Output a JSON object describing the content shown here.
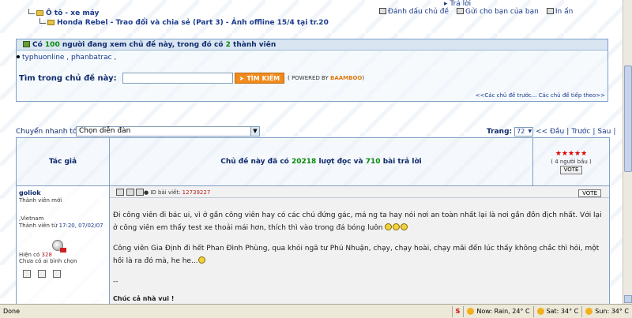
{
  "breadcrumb": {
    "level1": "Ô tô - xe máy",
    "level2": "Honda Rebel - Trao đổi và chia sẻ (Part 3) - Ảnh offline 15/4 tại tr.20"
  },
  "top_links": {
    "reply": "Trả lời",
    "bookmark": "Đánh dấu chủ đề",
    "send_friend": "Gửi cho bạn của bạn",
    "print": "In ấn"
  },
  "viewers": {
    "prefix": "Có ",
    "count": "100",
    "middle": " người đang xem chủ đề này, trong đó có ",
    "members_count": "2",
    "suffix": " thành viên",
    "members_list": "typhuonline , phanbatrac ,"
  },
  "search": {
    "label": "Tìm trong chủ đề này:",
    "value": "",
    "button": "TÌM KIẾM",
    "powered_prefix": "( POWERED BY ",
    "powered_brand": "BAAMBOO",
    "powered_suffix": ")"
  },
  "topic_nav": "<<Các chủ đề trước... Các chủ đề tiếp theo>>",
  "jump": {
    "label": "Chuyển nhanh tới:",
    "selected": "Chọn diễn đàn"
  },
  "pager": {
    "label": "Trang:",
    "page": "72",
    "first": "<< Đầu",
    "prev": "Trước",
    "next": "Sau",
    "sep": "|"
  },
  "table": {
    "author_header": "Tác giả",
    "stats_prefix": "Chủ đề này đã có ",
    "reads": "20218",
    "stats_middle": " lượt đọc và ",
    "replies": "710",
    "stats_suffix": " bài trả lời",
    "stars": "★★★★★",
    "rating_count": "( 4 người bầu )",
    "vote_label": "VOTE"
  },
  "post": {
    "author": "goliok",
    "rank": "Thành viên mới",
    "location": ",Vietnam",
    "joined_label": "Thành viên từ ",
    "joined_date": "17:20, 07/02/07",
    "current_label": "Hiện có ",
    "current_value": "328",
    "rating_text": "Chưa có ai bình chọn",
    "post_id_label": "ID bài viết: ",
    "post_id": "12739227",
    "vote_label": "VOTE",
    "paragraph1": "Đi công viên đi bác ui, vì ở gần công viên hay có các chú đứng gác, má ng ta hay nói nơi an toàn nhất lại là nơi gần đồn địch nhất. Với lại ở công viên em thấy test xe thoải mái hơn, thích thì vào trong đá bóng luôn",
    "paragraph2": "Công viên Gia Định đi hết Phan Đình Phùng, qua khỏi ngã tư Phú Nhuận, chạy, chạy hoài, chạy mãi đến lúc thấy không chắc thì hỏi, một hồi là ra đó mà, he he...",
    "separator": "--",
    "signature": "Chúc cả nhà vui !"
  },
  "statusbar": {
    "left": "Done",
    "si": "S",
    "weather_now": "Now: Rain, 24° C",
    "weather_sat": "Sat: 34° C",
    "weather_sun": "Sun: 34° C"
  }
}
